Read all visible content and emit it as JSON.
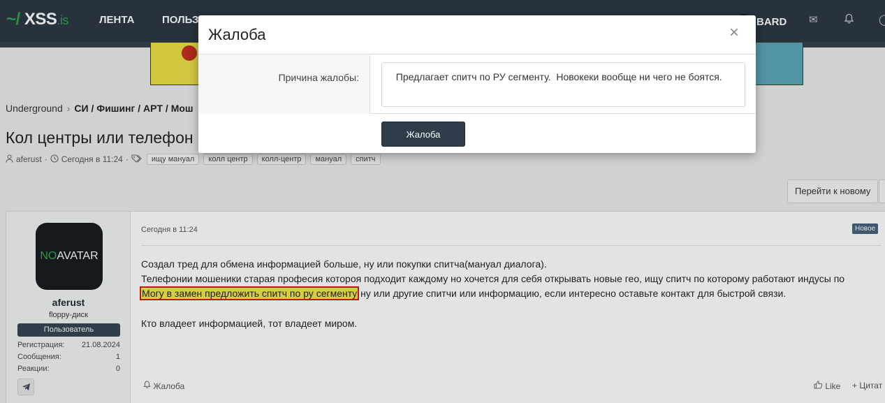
{
  "header": {
    "logo_tilde": "~/",
    "logo_name": "XSS",
    "logo_tld": ".is",
    "nav": [
      "ЛЕНТА",
      "ПОЛЬЗ"
    ],
    "user_name": "BARD",
    "icons": [
      "mail-icon",
      "bell-icon"
    ]
  },
  "breadcrumb": {
    "root": "Underground",
    "section": "СИ / Фишинг / APT / Мош"
  },
  "thread": {
    "title": "Кол центры или телефон",
    "author": "aferust",
    "time": "Сегодня в 11:24",
    "tags": [
      "ищу мануал",
      "колл центр",
      "колл-центр",
      "мануал",
      "спитч"
    ]
  },
  "actions": {
    "jump_new": "Перейти к новому"
  },
  "post": {
    "time": "Сегодня в 11:24",
    "new_badge": "Новое",
    "user": {
      "avatar_no": "NO",
      "avatar_text": "AVATAR",
      "name": "aferust",
      "title": "floppy-диск",
      "role": "Пользователь",
      "stats": [
        {
          "label": "Регистрация:",
          "value": "21.08.2024"
        },
        {
          "label": "Сообщения:",
          "value": "1"
        },
        {
          "label": "Реакции:",
          "value": "0"
        }
      ]
    },
    "lines": {
      "line1": "Создал тред для обмена информацией больше, ну или покупки спитча(мануал диалога).",
      "line2": "Телефонии мошеники старая професия котороя подходит каждому но хочется для себя открывать новые гео, ищу спитч по которому работают индусы по",
      "line3_highlight": "Могу в замен предложить спитч по ру сегменту",
      "line3_rest": " ну или другие спитчи или информацию, если интересно оставьте контакт для быстрой связи.",
      "line4": "Кто владеет информацией, тот владеет миром."
    },
    "footer": {
      "report": "Жалоба",
      "like": "Like",
      "quote": "+ Цитат"
    }
  },
  "modal": {
    "title": "Жалоба",
    "reason_label": "Причина жалобы:",
    "reason_value": "  Предлагает спитч по РУ сегменту.  Новокеки вообще ни чего не боятся.",
    "submit_label": "Жалоба"
  }
}
